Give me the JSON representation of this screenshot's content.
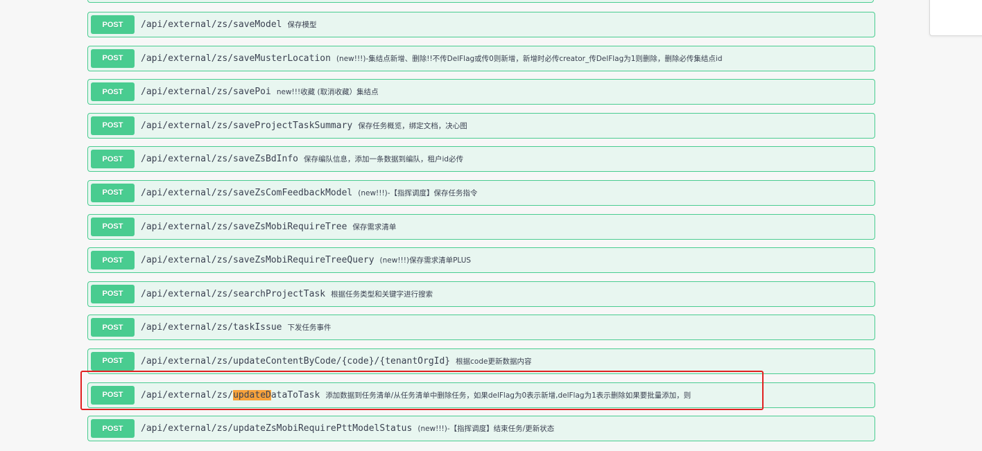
{
  "colors": {
    "post_green": "#49cc90",
    "row_background": "#e8f6f0",
    "search_highlight": "#f7a23b",
    "annotation_red": "#e02020"
  },
  "operations": [
    {
      "method": "POST",
      "path": "/api/external/zs/saveModel",
      "summary": "保存模型"
    },
    {
      "method": "POST",
      "path": "/api/external/zs/saveMusterLocation",
      "summary": "(new!!!)-集结点新增、删除!!不传DelFlag或传0则新增，新增时必传creator_传DelFlag为1则删除，删除必传集结点id"
    },
    {
      "method": "POST",
      "path": "/api/external/zs/savePoi",
      "summary": "new!!!收藏 (取消收藏）集结点"
    },
    {
      "method": "POST",
      "path": "/api/external/zs/saveProjectTaskSummary",
      "summary": "保存任务概览，绑定文档，决心图"
    },
    {
      "method": "POST",
      "path": "/api/external/zs/saveZsBdInfo",
      "summary": "保存编队信息，添加一条数据到编队，租户id必传"
    },
    {
      "method": "POST",
      "path": "/api/external/zs/saveZsComFeedbackModel",
      "summary": "(new!!!)-【指挥调度】保存任务指令"
    },
    {
      "method": "POST",
      "path": "/api/external/zs/saveZsMobiRequireTree",
      "summary": "保存需求清单"
    },
    {
      "method": "POST",
      "path": "/api/external/zs/saveZsMobiRequireTreeQuery",
      "summary": "(new!!!)保存需求清单PLUS"
    },
    {
      "method": "POST",
      "path": "/api/external/zs/searchProjectTask",
      "summary": "根据任务类型和关键字进行搜索"
    },
    {
      "method": "POST",
      "path": "/api/external/zs/taskIssue",
      "summary": "下发任务事件"
    },
    {
      "method": "POST",
      "path": "/api/external/zs/updateContentByCode/{code}/{tenantOrgId}",
      "summary": "根据code更新数据内容"
    },
    {
      "method": "POST",
      "path_prefix": "/api/external/zs/",
      "path_highlight": "updateD",
      "path_suffix": "ataToTask",
      "summary": "添加数据到任务清单/从任务清单中删除任务，如果delFlag为0表示新增,delFlag为1表示删除如果要批量添加，则"
    },
    {
      "method": "POST",
      "path": "/api/external/zs/updateZsMobiRequirePttModelStatus",
      "summary": "(new!!!)-【指挥调度】结束任务/更新状态"
    }
  ]
}
